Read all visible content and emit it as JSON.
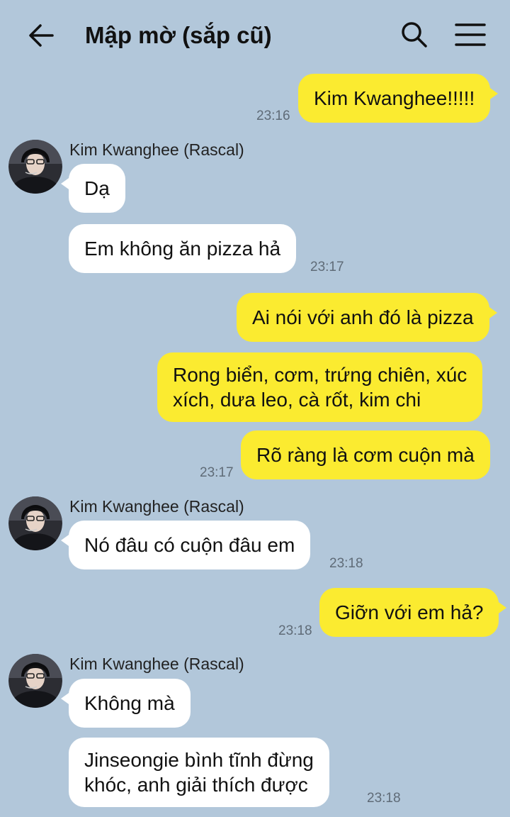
{
  "header": {
    "title": "Mập mờ (sắp cũ)",
    "back_icon": "arrow-left-icon",
    "search_icon": "search-icon",
    "menu_icon": "hamburger-menu-icon"
  },
  "colors": {
    "background": "#b2c7da",
    "outgoing_bubble": "#fbeb30",
    "incoming_bubble": "#ffffff"
  },
  "contact": {
    "name": "Kim Kwanghee (Rascal)"
  },
  "messages": [
    {
      "dir": "out",
      "text": "Kim Kwanghee!!!!!",
      "time": "23:16"
    },
    {
      "dir": "in",
      "text": "Dạ"
    },
    {
      "dir": "in",
      "text": "Em không ăn pizza hả",
      "time": "23:17"
    },
    {
      "dir": "out",
      "text": "Ai nói với anh đó là pizza"
    },
    {
      "dir": "out",
      "text": "Rong biển, cơm, trứng chiên, xúc\nxích, dưa leo, cà rốt, kim chi"
    },
    {
      "dir": "out",
      "text": "Rõ ràng là cơm cuộn mà",
      "time": "23:17"
    },
    {
      "dir": "in",
      "text": "Nó đâu có cuộn đâu em",
      "time": "23:18"
    },
    {
      "dir": "out",
      "text": "Giỡn với em hả?",
      "time": "23:18"
    },
    {
      "dir": "in",
      "text": "Không mà"
    },
    {
      "dir": "in",
      "text": "Jinseongie bình tĩnh đừng\nkhóc, anh giải thích được",
      "time": "23:18"
    }
  ]
}
